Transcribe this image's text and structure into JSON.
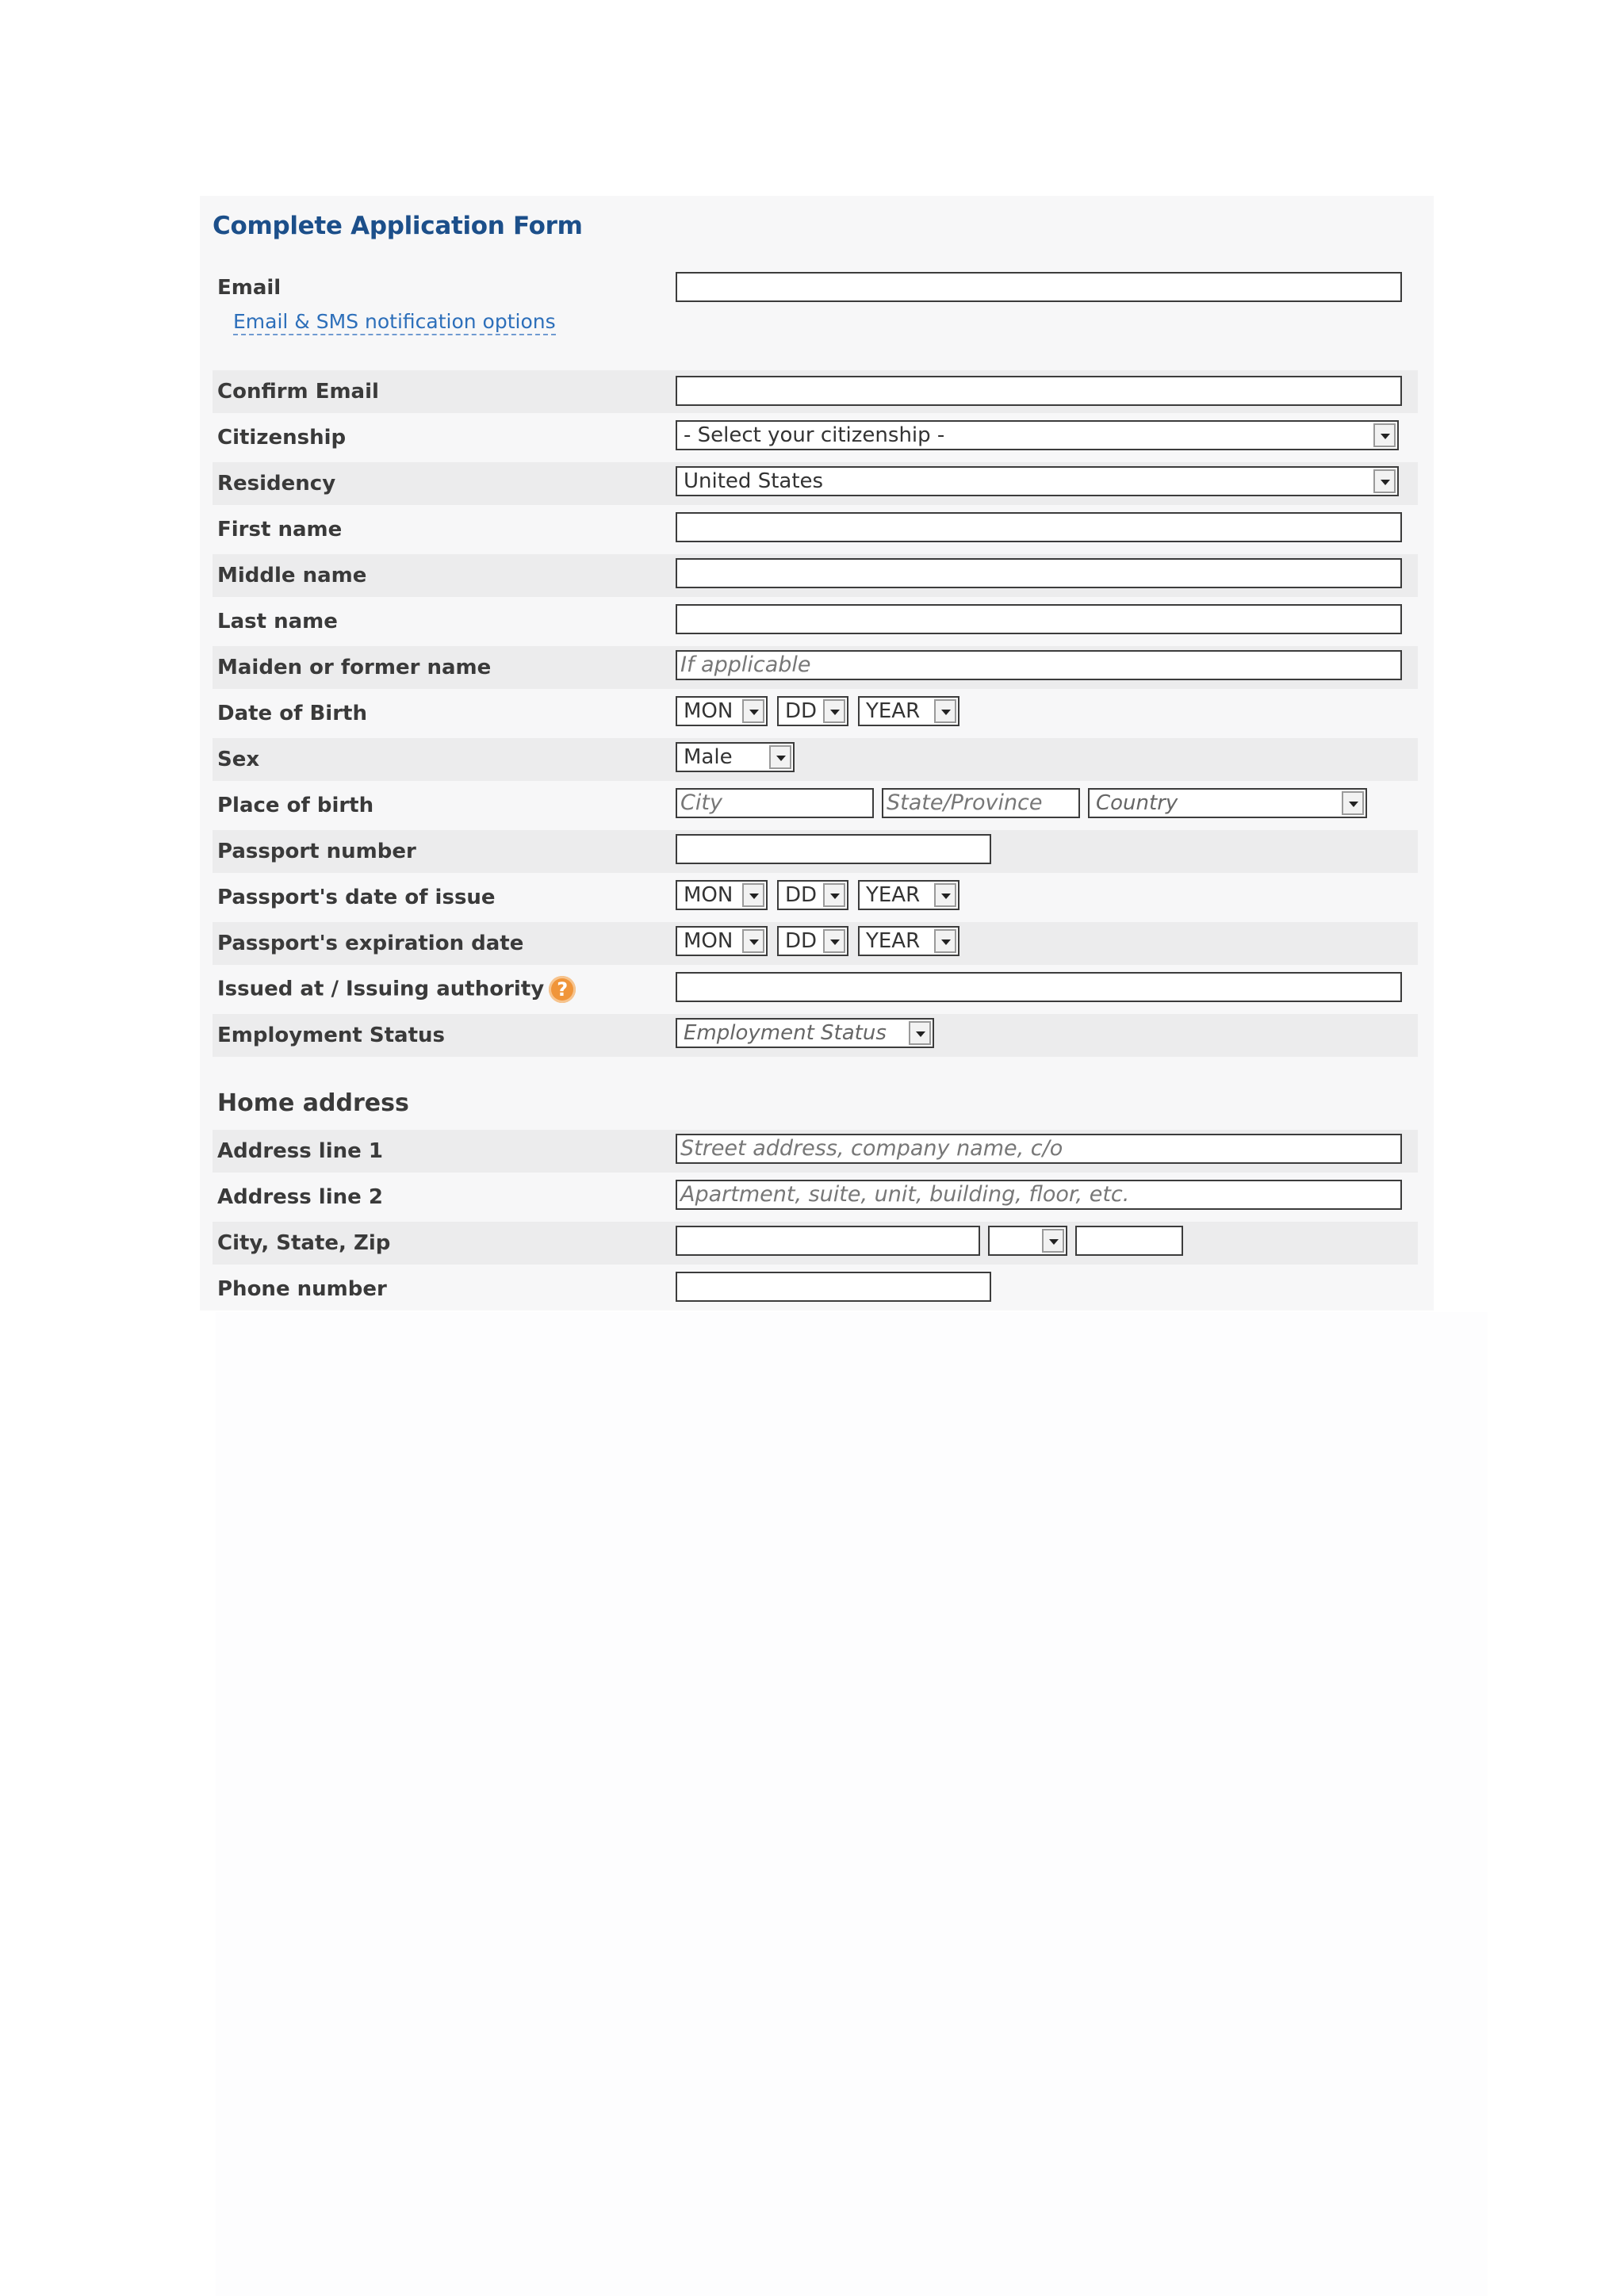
{
  "form": {
    "title": "Complete Application Form",
    "email": {
      "label": "Email",
      "value": ""
    },
    "notification_link": "Email & SMS notification options",
    "confirm_email": {
      "label": "Confirm Email",
      "value": ""
    },
    "citizenship": {
      "label": "Citizenship",
      "selected": "- Select your citizenship -"
    },
    "residency": {
      "label": "Residency",
      "selected": "United States"
    },
    "first_name": {
      "label": "First name",
      "value": ""
    },
    "middle_name": {
      "label": "Middle name",
      "value": ""
    },
    "last_name": {
      "label": "Last name",
      "value": ""
    },
    "maiden_name": {
      "label": "Maiden or former name",
      "placeholder": "If applicable"
    },
    "date_of_birth": {
      "label": "Date of Birth",
      "month": "MON",
      "day": "DD",
      "year": "YEAR"
    },
    "sex": {
      "label": "Sex",
      "selected": "Male"
    },
    "place_of_birth": {
      "label": "Place of birth",
      "city_placeholder": "City",
      "state_placeholder": "State/Province",
      "country_placeholder": "Country"
    },
    "passport_number": {
      "label": "Passport number",
      "value": ""
    },
    "passport_issue_date": {
      "label": "Passport's date of issue",
      "month": "MON",
      "day": "DD",
      "year": "YEAR"
    },
    "passport_expiration_date": {
      "label": "Passport's expiration date",
      "month": "MON",
      "day": "DD",
      "year": "YEAR"
    },
    "issuing_authority": {
      "label": "Issued at / Issuing authority",
      "help_glyph": "?",
      "value": ""
    },
    "employment_status": {
      "label": "Employment Status",
      "placeholder": "Employment Status"
    }
  },
  "home_address": {
    "heading": "Home address",
    "address_line_1": {
      "label": "Address line 1",
      "placeholder": "Street address, company name, c/o"
    },
    "address_line_2": {
      "label": "Address line 2",
      "placeholder": "Apartment, suite, unit, building, floor, etc."
    },
    "city_state_zip": {
      "label": "City, State, Zip",
      "city": "",
      "state": "",
      "zip": ""
    },
    "phone_number": {
      "label": "Phone number",
      "value": ""
    }
  },
  "colors": {
    "title": "#1c4f8a",
    "link": "#2d6fba",
    "help_icon": "#f0953a",
    "row_shade": "#ececed",
    "panel": "#f7f7f8"
  }
}
